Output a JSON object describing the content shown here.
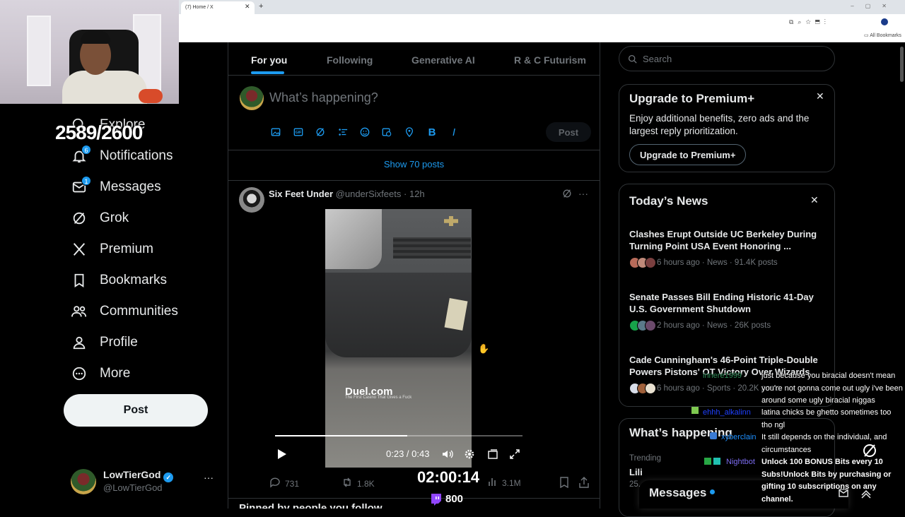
{
  "browser": {
    "tab_title": "(7) Home / X",
    "tab_close": "✕",
    "new_tab": "+",
    "bookmarks_label": "All Bookmarks"
  },
  "stream_overlay": {
    "sub_count": "2589/2600",
    "timer": "02:00:14",
    "bits": "800"
  },
  "nav": {
    "items": [
      {
        "label": "Explore",
        "icon": "search-icon"
      },
      {
        "label": "Notifications",
        "icon": "bell-icon",
        "badge": "6"
      },
      {
        "label": "Messages",
        "icon": "envelope-icon",
        "badge": "1"
      },
      {
        "label": "Grok",
        "icon": "grok-icon"
      },
      {
        "label": "Premium",
        "icon": "x-logo-icon"
      },
      {
        "label": "Bookmarks",
        "icon": "bookmark-icon"
      },
      {
        "label": "Communities",
        "icon": "people-icon"
      },
      {
        "label": "Profile",
        "icon": "person-icon"
      },
      {
        "label": "More",
        "icon": "more-circle-icon"
      }
    ],
    "post_button": "Post",
    "account": {
      "name": "LowTierGod",
      "handle": "@LowTierGod",
      "menu": "···"
    }
  },
  "main": {
    "tabs": [
      "For you",
      "Following",
      "Generative AI",
      "R & C Futurism"
    ],
    "compose": {
      "placeholder": "What’s happening?",
      "post_button": "Post",
      "tools": [
        "image-icon",
        "gif-icon",
        "grok-icon",
        "poll-icon",
        "emoji-icon",
        "schedule-icon",
        "location-icon",
        "bold-icon",
        "italic-icon"
      ]
    },
    "show_posts": "Show 70 posts",
    "tweet": {
      "author": "Six Feet Under",
      "handle": "@underSixfeets",
      "sep": "·",
      "time": "12h",
      "video": {
        "watermark": "Duel.com",
        "watermark_sub": "The First Casino That Gives a Fuck",
        "time": "0:23 / 0:43",
        "progress": 0.535
      },
      "actions": {
        "replies": "731",
        "reposts": "1.8K",
        "views": "3.1M"
      }
    },
    "next_section": "Pinned by people you follow"
  },
  "right": {
    "search_placeholder": "Search",
    "premium": {
      "title": "Upgrade to Premium+",
      "body": "Enjoy additional benefits, zero ads and the largest reply prioritization.",
      "button": "Upgrade to Premium+"
    },
    "news": {
      "title": "Today’s News",
      "items": [
        {
          "headline": "Clashes Erupt Outside UC Berkeley During Turning Point USA Event Honoring ...",
          "meta": "6 hours ago · News · 91.4K posts"
        },
        {
          "headline": "Senate Passes Bill Ending Historic 41-Day U.S. Government Shutdown",
          "meta": "2 hours ago · News · 26K posts"
        },
        {
          "headline": "Cade Cunningham's 46-Point Triple-Double Powers Pistons' OT Victory Over Wizards",
          "meta": "6 hours ago · Sports · 20.2K posts"
        }
      ]
    },
    "happening": {
      "title": "What’s happening",
      "trending_label": "Trending",
      "trend_name": "Lili",
      "trend_count": "25."
    },
    "messages_drawer": "Messages"
  },
  "chat": [
    {
      "user": "innere1999",
      "user_color": "#2e8b57",
      "text": "just because you biracial doesn't mean you're not gonna come out ugly i've been around some ugly biracial niggas"
    },
    {
      "user": "ehhh_alkalinn",
      "user_color": "#1e40ff",
      "text": "latina chicks be ghetto sometimes too tho ngl"
    },
    {
      "user": "xyberclain",
      "user_color": "#1e90ff",
      "text": "It still depends on the individual, and circumstances"
    },
    {
      "user": "Nightbot",
      "user_color": "#7c6cf0",
      "text": "Unlock 100 BONUS Bits every 10 Subs!Unlock Bits by purchasing or gifting 10 subscriptions on any channel."
    }
  ],
  "colors": {
    "accent": "#1d9bf0",
    "border": "#2f3336",
    "muted": "#71767b"
  }
}
